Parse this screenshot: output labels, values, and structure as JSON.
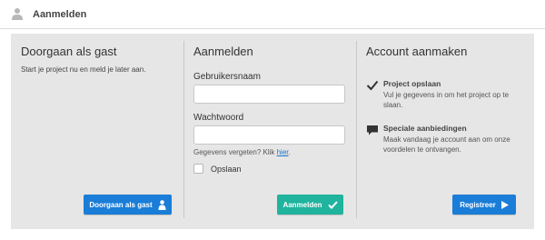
{
  "header": {
    "title": "Aanmelden",
    "icon": "user-icon"
  },
  "guest": {
    "heading": "Doorgaan als gast",
    "description": "Start je project nu en meld je later aan.",
    "button_label": "Doorgaan als gast",
    "button_icon": "person-icon"
  },
  "login": {
    "heading": "Aanmelden",
    "username_label": "Gebruikersnaam",
    "username_value": "",
    "password_label": "Wachtwoord",
    "password_value": "",
    "forgot_text": "Gegevens vergeten? Klik ",
    "forgot_link": "hier",
    "forgot_suffix": ".",
    "remember_label": "Opslaan",
    "remember_checked": false,
    "button_label": "Aanmelden",
    "button_icon": "checkmark-icon"
  },
  "account": {
    "heading": "Account aanmaken",
    "features": [
      {
        "icon": "checkmark-icon",
        "title": "Project opslaan",
        "description": "Vul je gegevens in om het project op te slaan."
      },
      {
        "icon": "speech-bubble-icon",
        "title": "Speciale aanbiedingen",
        "description": "Maak vandaag je account aan om onze voordelen te ontvangen."
      }
    ],
    "button_label": "Registreer",
    "button_icon": "play-arrow-icon"
  },
  "colors": {
    "primary_blue": "#1a7dd7",
    "teal": "#20b39e",
    "panel_bg": "#e6e6e6",
    "link": "#1b73c9"
  }
}
